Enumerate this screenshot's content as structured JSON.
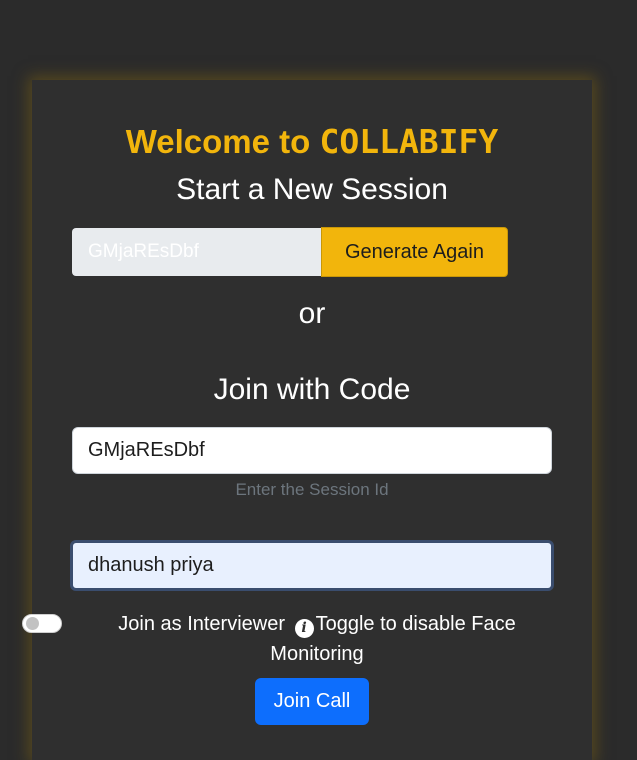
{
  "header": {
    "title_prefix": "Welcome to ",
    "brand": "COLLABIFY",
    "new_session_heading": "Start a New Session"
  },
  "generate": {
    "session_id": "GMjaREsDbf",
    "button_label": "Generate Again"
  },
  "separator": "or",
  "join": {
    "heading": "Join with Code",
    "code_value": "GMjaREsDbf",
    "code_hint": "Enter the Session Id",
    "name_value": "dhanush priya"
  },
  "interviewer": {
    "enabled": false,
    "label": "Join as Interviewer",
    "info_icon": "info-icon",
    "hint": "Toggle to disable Face Monitoring"
  },
  "join_button_label": "Join Call",
  "colors": {
    "accent": "#f2b50c",
    "primary_button": "#0d6efd",
    "background": "#2b2b2b"
  }
}
